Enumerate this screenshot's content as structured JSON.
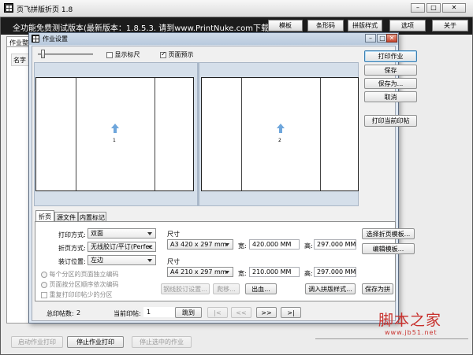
{
  "main_window": {
    "title": "页飞拼版折页 1.8",
    "banner": "全功能免费测试版本(最新版本：1.8.5.3. 请到www.PrintNuke.com下载安",
    "toolbar": [
      "模板",
      "条形码",
      "拼版样式",
      "选项",
      "关于"
    ],
    "left_tab_partial": "作业整",
    "left_col_partial": "名字",
    "bottom_buttons": [
      {
        "label": "启动作业打印",
        "enabled": false
      },
      {
        "label": "停止作业打印",
        "enabled": true
      },
      {
        "label": "停止选中的作业",
        "enabled": false
      }
    ]
  },
  "dialog": {
    "title": "作业设置",
    "show_ruler": "显示标尺",
    "show_ruler_checked": false,
    "page_preview": "页面预示",
    "page_preview_checked": true,
    "pages": [
      {
        "number": "1"
      },
      {
        "number": "2"
      }
    ],
    "right_buttons": [
      "打印作业",
      "保存",
      "保存为...",
      "取消",
      "打印当前印帖"
    ],
    "tabs": [
      "折页",
      "源文件",
      "内置标记"
    ],
    "active_tab": "折页",
    "form": {
      "print_mode_label": "打印方式:",
      "print_mode_value": "双面",
      "fold_mode_label": "折页方式:",
      "fold_mode_value": "无线胶订/平订(Perfec",
      "binding_label": "装订位置:",
      "binding_value": "左边",
      "size_label_1": "尺寸",
      "size_value_1": "A3 420 x 297 mm",
      "width_label_1": "宽:",
      "width_value_1": "420.000 MM",
      "height_label_1": "高:",
      "height_value_1": "297.000 MM",
      "size_label_2": "尺寸",
      "size_value_2": "A4 210 x 297 mm",
      "width_label_2": "宽:",
      "width_value_2": "210.000 MM",
      "height_label_2": "高:",
      "height_value_2": "297.000 MM",
      "radio_1": "每个分区的页面独立编码",
      "radio_2": "页面按分区顺序依次编码",
      "check_1": "重复打印印帖少的分区",
      "btn_bleed": "钢线胶订设置...",
      "btn_crop": "爬移...",
      "btn_bleed2": "出血...",
      "btn_import_style": "调入拼版样式...",
      "btn_save_as_style": "保存为拼",
      "btn_select_template": "选择折页模板...",
      "btn_edit_template": "编辑模板..."
    },
    "footer": {
      "total_label": "总印帖数:",
      "total_value": "2",
      "current_label": "当前印帖:",
      "current_value": "1",
      "goto": "跳到",
      "nav_first": "|<",
      "nav_prev": "<<",
      "nav_next": ">>",
      "nav_last": ">|"
    }
  },
  "watermark": {
    "text": "脚本之家",
    "url": "www.jb51.net"
  }
}
